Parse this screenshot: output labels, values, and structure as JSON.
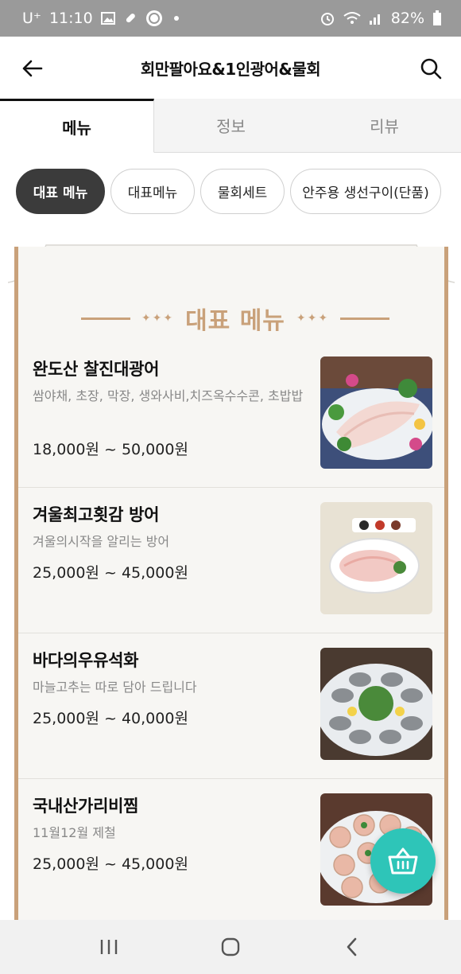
{
  "status_bar": {
    "carrier": "U⁺",
    "time": "11:10",
    "battery": "82%"
  },
  "header": {
    "title": "회만팔아요&1인광어&물회"
  },
  "tabs": [
    {
      "label": "메뉴"
    },
    {
      "label": "정보"
    },
    {
      "label": "리뷰"
    }
  ],
  "chips": [
    {
      "label": "대표 메뉴"
    },
    {
      "label": "대표메뉴"
    },
    {
      "label": "물회세트"
    },
    {
      "label": "안주용 생선구이(단품)"
    }
  ],
  "section": {
    "title": "대표 메뉴",
    "stars": "✦✦✦"
  },
  "menu_items": [
    {
      "name": "완도산 찰진대광어",
      "desc": "쌈야채, 초장, 막장, 생와사비,치즈옥수수콘, 초밥밥",
      "price": "18,000원 ~ 50,000원"
    },
    {
      "name": "겨울최고횟감 방어",
      "desc": "겨울의시작을 알리는 방어",
      "price": "25,000원 ~ 45,000원"
    },
    {
      "name": "바다의우유석화",
      "desc": "마늘고추는 따로 담아 드립니다",
      "price": "25,000원 ~ 40,000원"
    },
    {
      "name": "국내산가리비찜",
      "desc": "11월12월 제철",
      "price": "25,000원 ~ 45,000원"
    }
  ],
  "colors": {
    "accent_gold": "#c9a17a",
    "fab": "#2ec5b8",
    "chip_active": "#3b3b3b"
  }
}
